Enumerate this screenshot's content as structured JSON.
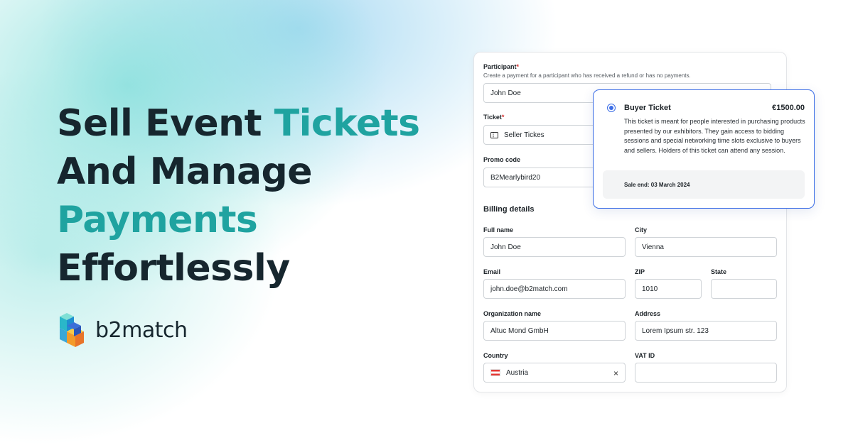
{
  "headline": {
    "line1_plain": "Sell Event ",
    "line1_accent": "Tickets",
    "line2": "And Manage",
    "line3_accent": "Payments",
    "line4": "Effortlessly"
  },
  "logo": {
    "text": "b2match",
    "icon": "b2match-logo-icon"
  },
  "colors": {
    "accent": "#1fa3a0",
    "dark": "#16262e",
    "primary_blue": "#3c6ee6",
    "required": "#d32f2f"
  },
  "form": {
    "participant": {
      "label": "Participant",
      "required_mark": "*",
      "hint": "Create a payment for a participant who has received a refund or has no payments.",
      "value": "John Doe"
    },
    "ticket": {
      "label": "Ticket",
      "required_mark": "*",
      "value": "Seller Tickes",
      "icon": "ticket-icon"
    },
    "promo": {
      "label": "Promo code",
      "value": "B2Mearlybird20"
    },
    "billing_title": "Billing details",
    "full_name": {
      "label": "Full name",
      "value": "John Doe"
    },
    "city": {
      "label": "City",
      "value": "Vienna"
    },
    "email": {
      "label": "Email",
      "value": "john.doe@b2match.com"
    },
    "zip": {
      "label": "ZIP",
      "value": "1010"
    },
    "state": {
      "label": "State",
      "value": ""
    },
    "organization": {
      "label": "Organization name",
      "value": "Altuc Mond GmbH"
    },
    "address": {
      "label": "Address",
      "value": "Lorem Ipsum str. 123"
    },
    "country": {
      "label": "Country",
      "value": "Austria",
      "flag": "austria-flag-icon",
      "clear": "×"
    },
    "vat": {
      "label": "VAT ID",
      "value": ""
    }
  },
  "ticket_option": {
    "name": "Buyer Ticket",
    "price": "€1500.00",
    "description": "This ticket is meant for people interested in purchasing products presented by our exhibitors. They gain access to bidding sessions and special networking time slots exclusive to buyers and sellers. Holders of this ticket can attend any session.",
    "sale_end": "Sale end: 03 March 2024",
    "selected": true
  }
}
